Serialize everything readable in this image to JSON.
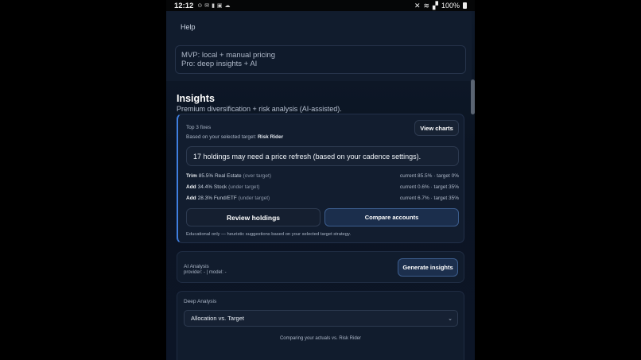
{
  "status_bar": {
    "time": "12:12",
    "battery": "100%",
    "icons": [
      "notification-icons",
      "wifi-icon",
      "signal-icon",
      "mute-icon",
      "battery-icon"
    ]
  },
  "help": {
    "label": "Help"
  },
  "plan_box": {
    "line1": "MVP: local + manual pricing",
    "line2": "Pro: deep insights + AI"
  },
  "insights": {
    "title": "Insights",
    "subtitle": "Premium diversification + risk analysis (AI-assisted).",
    "top_fixes_label": "Top 3 fixes",
    "based_on_prefix": "Based on your selected target:",
    "target_name": "Risk Rider",
    "view_charts": "View charts",
    "refresh_message": "17 holdings may need a price refresh (based on your cadence settings).",
    "fixes": [
      {
        "action": "Trim",
        "text": "85.5% Real Estate",
        "note": "(over target)",
        "current": "current 85.5% · target 0%"
      },
      {
        "action": "Add",
        "text": "34.4% Stock",
        "note": "(under target)",
        "current": "current 0.6% · target 35%"
      },
      {
        "action": "Add",
        "text": "28.3% Fund/ETF",
        "note": "(under target)",
        "current": "current 6.7% · target 35%"
      }
    ],
    "review_holdings": "Review holdings",
    "compare_accounts": "Compare accounts",
    "educational_note": "Educational only — heuristic suggestions based on your selected target strategy."
  },
  "ai_analysis": {
    "title": "AI Analysis",
    "provider_line": "provider: - | model: -",
    "generate_button": "Generate insights"
  },
  "deep_analysis": {
    "title": "Deep Analysis",
    "selected_option": "Allocation vs. Target",
    "comparing_text": "Comparing your actuals vs. Risk Rider"
  },
  "colors": {
    "accent": "#3f7fe0",
    "background": "#0c1524",
    "card": "#121d2f"
  }
}
